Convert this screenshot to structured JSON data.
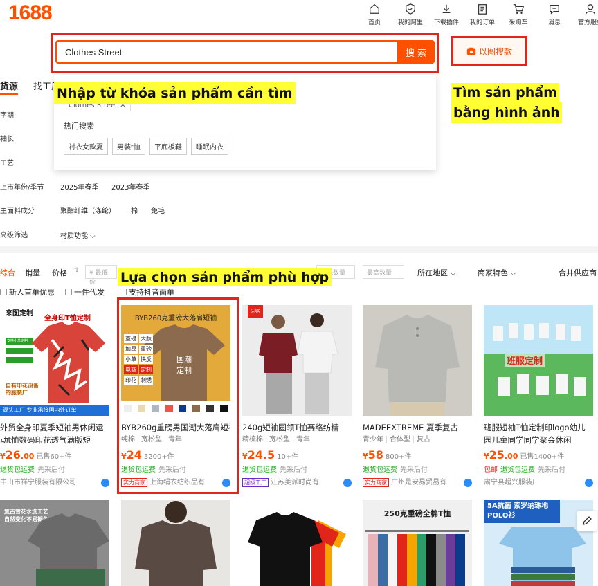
{
  "logo": "1688",
  "nav": [
    {
      "label": "首页",
      "icon": "home-icon"
    },
    {
      "label": "我的阿里",
      "icon": "user-shield-icon"
    },
    {
      "label": "下载插件",
      "icon": "download-icon"
    },
    {
      "label": "我的订单",
      "icon": "clipboard-icon"
    },
    {
      "label": "采购车",
      "icon": "cart-icon"
    },
    {
      "label": "消息",
      "icon": "message-icon"
    },
    {
      "label": "官方服务",
      "icon": "service-icon"
    }
  ],
  "search": {
    "value": "Clothes Street",
    "button": "搜 索",
    "image_search": "以图搜款"
  },
  "annotations": {
    "keyword": "Nhập từ khóa sản phẩm cần tìm",
    "image": [
      "Tìm sản phẩm",
      "bằng hình ảnh"
    ],
    "select": "Lựa chọn sản phẩm phù hợp"
  },
  "dropdown": {
    "history_tag": "Clothes Street",
    "hot_title": "热门搜索",
    "hot_tags": [
      "衬衣女款夏",
      "男装t恤",
      "平底板鞋",
      "睡眠内衣"
    ]
  },
  "tabs": [
    "货源",
    "找工厂"
  ],
  "filters": [
    {
      "label": "字期",
      "options": []
    },
    {
      "label": "袖长",
      "options": []
    },
    {
      "label": "工艺",
      "options": []
    },
    {
      "label": "上市年份/季节",
      "options": [
        "2025年春季",
        "2023年春季"
      ]
    },
    {
      "label": "主面料成分",
      "options": [
        "聚酯纤维（涤纶）",
        "棉",
        "兔毛"
      ]
    },
    {
      "label": "高级筛选",
      "options": [
        "材质功能 ⌵"
      ]
    }
  ],
  "sort": {
    "items": [
      "综合",
      "销量",
      "价格"
    ],
    "min_price": "¥ 最低价",
    "min_qty": "最低数量",
    "max_qty": "最高数量",
    "region": "所在地区",
    "merchant": "商家特色",
    "merge": "合并供应商"
  },
  "checks": [
    "新人首单优惠",
    "一件代发",
    "支持抖音面单"
  ],
  "products": [
    {
      "title": "外贸全身印夏季短袖男休闲运动t恤数码印花透气满版短",
      "attrs": [],
      "price": "26",
      "cents": ".00",
      "sold": "已售60+件",
      "service": [
        "退货包运费",
        "先采后付"
      ],
      "shop": "中山市祥宁服装有限公司",
      "badge": "",
      "img_top": "来图定制",
      "img_sub": "支持小单定制",
      "img_bottom": "源头工厂 专业承接国内外订单",
      "img_heading": "全身印T恤定制"
    },
    {
      "title": "BYB260g重磅男国潮大落肩短袖",
      "attrs": [
        "纯棉",
        "宽松型",
        "青年"
      ],
      "price": "24",
      "cents": "",
      "sold": "3200+件",
      "service": [
        "退货包运费",
        "先采后付"
      ],
      "shop": "上海绢衣纺织品有",
      "badge": "实力商家",
      "img_top": "BYB260克重磅大落肩短袖",
      "img_tags": [
        "重磅",
        "加厚",
        "小单",
        "电商",
        "印花"
      ],
      "img_tags2": [
        "大版",
        "重磅",
        "快反",
        "定制",
        "刺绣"
      ],
      "img_center": "国潮定制"
    },
    {
      "title": "240g短袖圆领T恤赛络纺精",
      "attrs": [
        "精梳棉",
        "宽松型",
        "青年"
      ],
      "price": "24.5",
      "cents": "",
      "sold": "10+件",
      "service": [
        "退货包运费",
        "先采后付"
      ],
      "shop": "江苏美派时尚有",
      "badge": "超级工厂",
      "img_tag": "闪购"
    },
    {
      "title": "MADEEXTREME 夏季复古",
      "attrs": [
        "青少年",
        "合体型",
        "复古"
      ],
      "price": "58",
      "cents": "",
      "sold": "800+件",
      "service": [
        "退货包运费",
        "先采后付"
      ],
      "shop": "广州是安易贸易有",
      "badge": "实力商家"
    },
    {
      "title": "班服短袖T恤定制印logo幼儿园儿童同学同学聚会休闲",
      "attrs": [],
      "price": "25",
      "cents": ".00",
      "sold": "已售1400+件",
      "service": [
        "包邮",
        "退货包运费",
        "先采后付"
      ],
      "shop": "肃宁县超兴服装厂",
      "badge": "",
      "img_heading": "班服定制"
    }
  ],
  "row2": [
    {
      "img_text": "复古雪花水洗工艺 自然变化不易褪色"
    },
    {
      "img_text": ""
    },
    {
      "img_text": ""
    },
    {
      "img_text": "250克重磅全棉T恤"
    },
    {
      "img_text": "5A抗菌 索罗纳珠地POLO衫"
    }
  ]
}
